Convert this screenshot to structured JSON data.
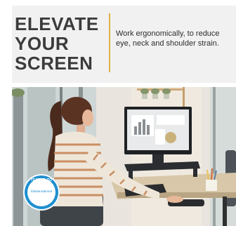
{
  "headline": {
    "line1": "ELEVATE",
    "line2": "YOUR",
    "line3": "SCREEN"
  },
  "subline": "Work ergonomically, to reduce eye, neck and shoulder strain.",
  "badge": {
    "top_text": "TESTED TO",
    "brand_text": "ifainternational",
    "bottom_text": "G1-B-31"
  },
  "colors": {
    "banner_bg": "#f1f1f1",
    "headline": "#3b3b3b",
    "divider": "#e0b24a",
    "badge": "#1e8fcf"
  }
}
